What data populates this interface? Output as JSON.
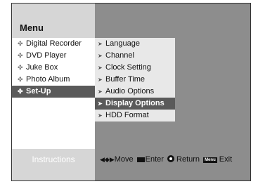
{
  "menu": {
    "title": "Menu",
    "items": [
      {
        "label": "Digital Recorder",
        "active": false
      },
      {
        "label": "DVD Player",
        "active": false
      },
      {
        "label": "Juke Box",
        "active": false
      },
      {
        "label": "Photo Album",
        "active": false
      },
      {
        "label": "Set-Up",
        "active": true
      }
    ]
  },
  "submenu": {
    "items": [
      {
        "label": "Language",
        "active": false
      },
      {
        "label": "Channel",
        "active": false
      },
      {
        "label": "Clock Setting",
        "active": false
      },
      {
        "label": "Buffer Time",
        "active": false
      },
      {
        "label": "Audio Options",
        "active": false
      },
      {
        "label": "Display Options",
        "active": true
      },
      {
        "label": "HDD Format",
        "active": false
      }
    ]
  },
  "footer": {
    "label": "Instructions",
    "move": "Move",
    "enter": "Enter",
    "return": "Return",
    "menu_key": "Menu",
    "exit": "Exit"
  },
  "colors": {
    "panel_gray": "#8d8d8d",
    "light_gray": "#d6d6d6",
    "highlight": "#5a5a5a",
    "item_bg": "#e8e8e8"
  },
  "icons": {
    "bullet": "diamond-bullet-icon",
    "arrow": "right-arrow-icon",
    "nav": "four-way-arrows-icon",
    "enter": "enter-key-icon",
    "return": "return-icon",
    "menu": "menu-key-icon"
  }
}
